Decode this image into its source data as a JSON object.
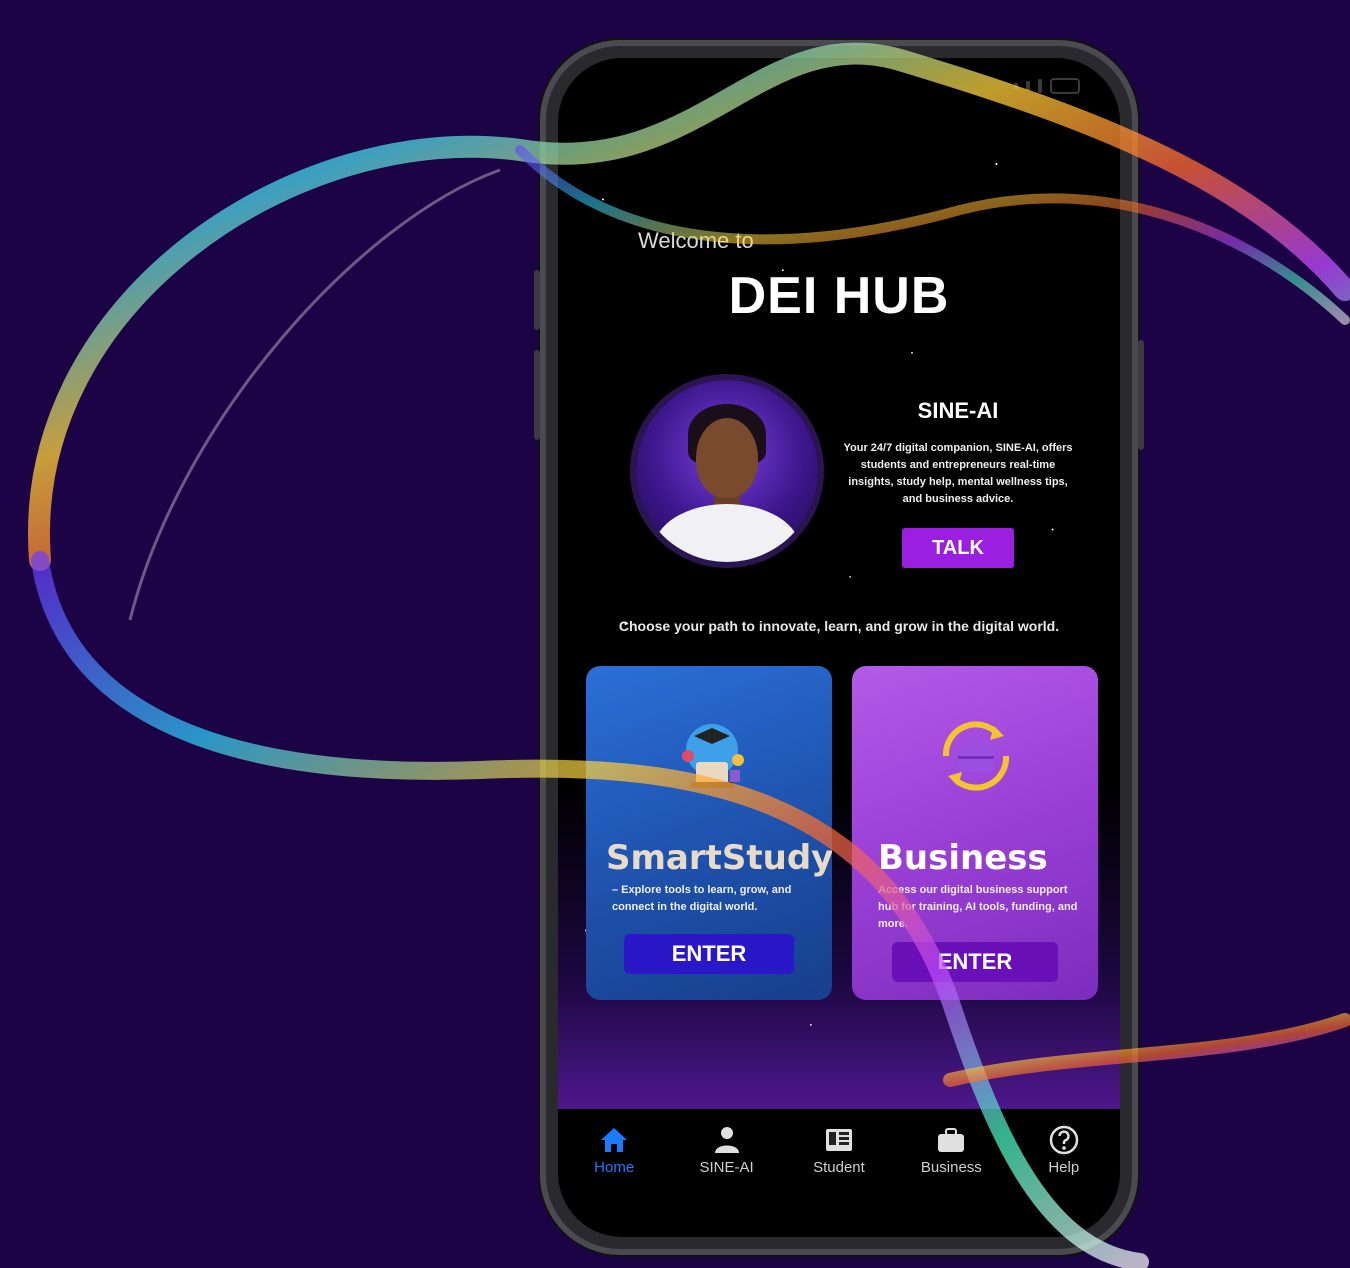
{
  "header": {
    "welcome": "Welcome to",
    "title": "DEI HUB"
  },
  "ai": {
    "name": "SINE-AI",
    "description": "Your 24/7 digital companion, SINE-AI, offers students and entrepreneurs real-time insights, study help, mental wellness tips, and business advice.",
    "button": "TALK"
  },
  "tagline": "Choose your path to innovate, learn, and grow in the digital world.",
  "cards": {
    "study": {
      "title": "SmartStudy",
      "description": "– Explore tools to learn, grow, and connect in the digital world.",
      "button": "ENTER"
    },
    "business": {
      "title": "Business",
      "description": "Access our digital business support hub for training, AI tools, funding, and more.",
      "button": "ENTER"
    }
  },
  "nav": {
    "items": [
      {
        "label": "Home",
        "icon": "home-icon",
        "active": true
      },
      {
        "label": "SINE-AI",
        "icon": "person-icon",
        "active": false
      },
      {
        "label": "Student",
        "icon": "book-icon",
        "active": false
      },
      {
        "label": "Business",
        "icon": "briefcase-icon",
        "active": false
      },
      {
        "label": "Help",
        "icon": "help-icon",
        "active": false
      }
    ]
  },
  "colors": {
    "background": "#1c0345",
    "accent_purple": "#9a1fe0",
    "nav_active": "#1a7bff",
    "study_card": "#1d4fa8",
    "business_card": "#9a3fd6"
  }
}
